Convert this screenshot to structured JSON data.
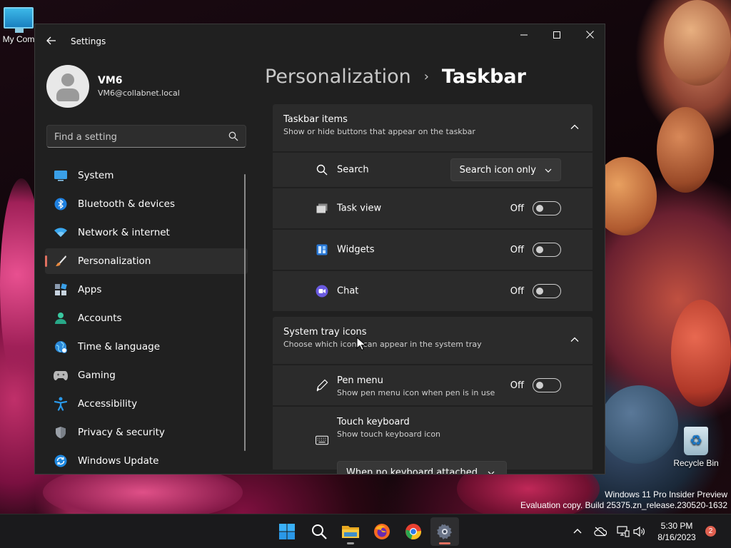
{
  "desktop": {
    "icons": {
      "my_computer": "My Com",
      "recycle_bin": "Recycle Bin"
    },
    "watermark": {
      "line1": "Windows 11 Pro Insider Preview",
      "line2": "Evaluation copy. Build 25375.zn_release.230520-1632"
    }
  },
  "window": {
    "title": "Settings",
    "user": {
      "name": "VM6",
      "email": "VM6@collabnet.local"
    },
    "search": {
      "placeholder": "Find a setting"
    },
    "nav": [
      {
        "label": "System",
        "icon": "system-icon",
        "active": false
      },
      {
        "label": "Bluetooth & devices",
        "icon": "bluetooth-icon",
        "active": false
      },
      {
        "label": "Network & internet",
        "icon": "wifi-icon",
        "active": false
      },
      {
        "label": "Personalization",
        "icon": "brush-icon",
        "active": true
      },
      {
        "label": "Apps",
        "icon": "apps-icon",
        "active": false
      },
      {
        "label": "Accounts",
        "icon": "accounts-icon",
        "active": false
      },
      {
        "label": "Time & language",
        "icon": "globe-icon",
        "active": false
      },
      {
        "label": "Gaming",
        "icon": "gamepad-icon",
        "active": false
      },
      {
        "label": "Accessibility",
        "icon": "accessibility-icon",
        "active": false
      },
      {
        "label": "Privacy & security",
        "icon": "shield-icon",
        "active": false
      },
      {
        "label": "Windows Update",
        "icon": "update-icon",
        "active": false
      }
    ],
    "breadcrumb": {
      "parent": "Personalization",
      "separator": "›",
      "current": "Taskbar"
    },
    "taskbar_items": {
      "title": "Taskbar items",
      "subtitle": "Show or hide buttons that appear on the taskbar",
      "search": {
        "label": "Search",
        "value": "Search icon only"
      },
      "task_view": {
        "label": "Task view",
        "state": "Off"
      },
      "widgets": {
        "label": "Widgets",
        "state": "Off"
      },
      "chat": {
        "label": "Chat",
        "state": "Off"
      }
    },
    "system_tray": {
      "title": "System tray icons",
      "subtitle": "Choose which icons can appear in the system tray",
      "pen_menu": {
        "label": "Pen menu",
        "subtitle": "Show pen menu icon when pen is in use",
        "state": "Off"
      },
      "touch_keyboard": {
        "label": "Touch keyboard",
        "subtitle": "Show touch keyboard icon",
        "value": "When no keyboard attached"
      }
    }
  },
  "taskbar": {
    "apps": [
      "start-icon",
      "search-icon",
      "file-explorer-icon",
      "firefox-icon",
      "chrome-icon",
      "settings-icon"
    ],
    "clock": {
      "time": "5:30 PM",
      "date": "8/16/2023"
    },
    "notifications": "2"
  },
  "colors": {
    "accent": "#e07060",
    "window_bg": "#202020",
    "card_bg": "#2b2b2b"
  }
}
